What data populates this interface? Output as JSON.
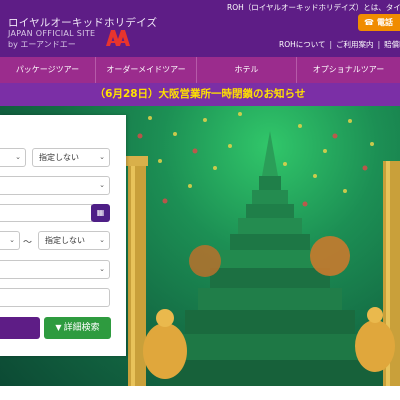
{
  "header": {
    "brand_jp": "ロイヤルオーキッドホリデイズ",
    "brand_en": "JAPAN OFFICIAL SITE",
    "brand_by": "by エーアンドエー",
    "logo_text": "A&A",
    "roh_notice": "ROH（ロイヤルオーキッドホリデイズ）とは、タイ国際航空",
    "phone_label": "電話",
    "phone_icon": "phone-icon",
    "links": [
      "ROHについて",
      "ご利用案内",
      "賠償時割"
    ]
  },
  "nav": {
    "items": [
      "パッケージツアー",
      "オーダーメイドツアー",
      "ホテル",
      "オプショナルツアー"
    ]
  },
  "announcement": "（6月28日）大阪営業所一時閉鎖のお知らせ",
  "search": {
    "select_unspecified": "指定しない",
    "tilde": "〜",
    "detail_label": "詳細検索",
    "filter_icon": "filter-icon",
    "calendar_icon": "calendar-icon"
  },
  "colors": {
    "header_bg": "#5e1d86",
    "nav_bg": "#9b2c8d",
    "announce_text": "#ffe100",
    "phone_btn": "#f08c00",
    "detail_btn": "#2e9b3f"
  }
}
